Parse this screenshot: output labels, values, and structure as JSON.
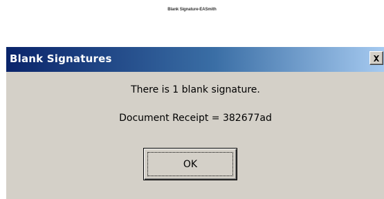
{
  "page": {
    "caption": "Blank Signature-EASmith"
  },
  "dialog": {
    "title": "Blank Signatures",
    "message": "There is 1 blank signature.",
    "receipt": "Document Receipt = 382677ad",
    "ok_label": "OK",
    "close_icon": "close-icon",
    "colors": {
      "titlebar_start": "#0a246a",
      "titlebar_end": "#a6caf0",
      "face": "#d4d0c8"
    }
  }
}
